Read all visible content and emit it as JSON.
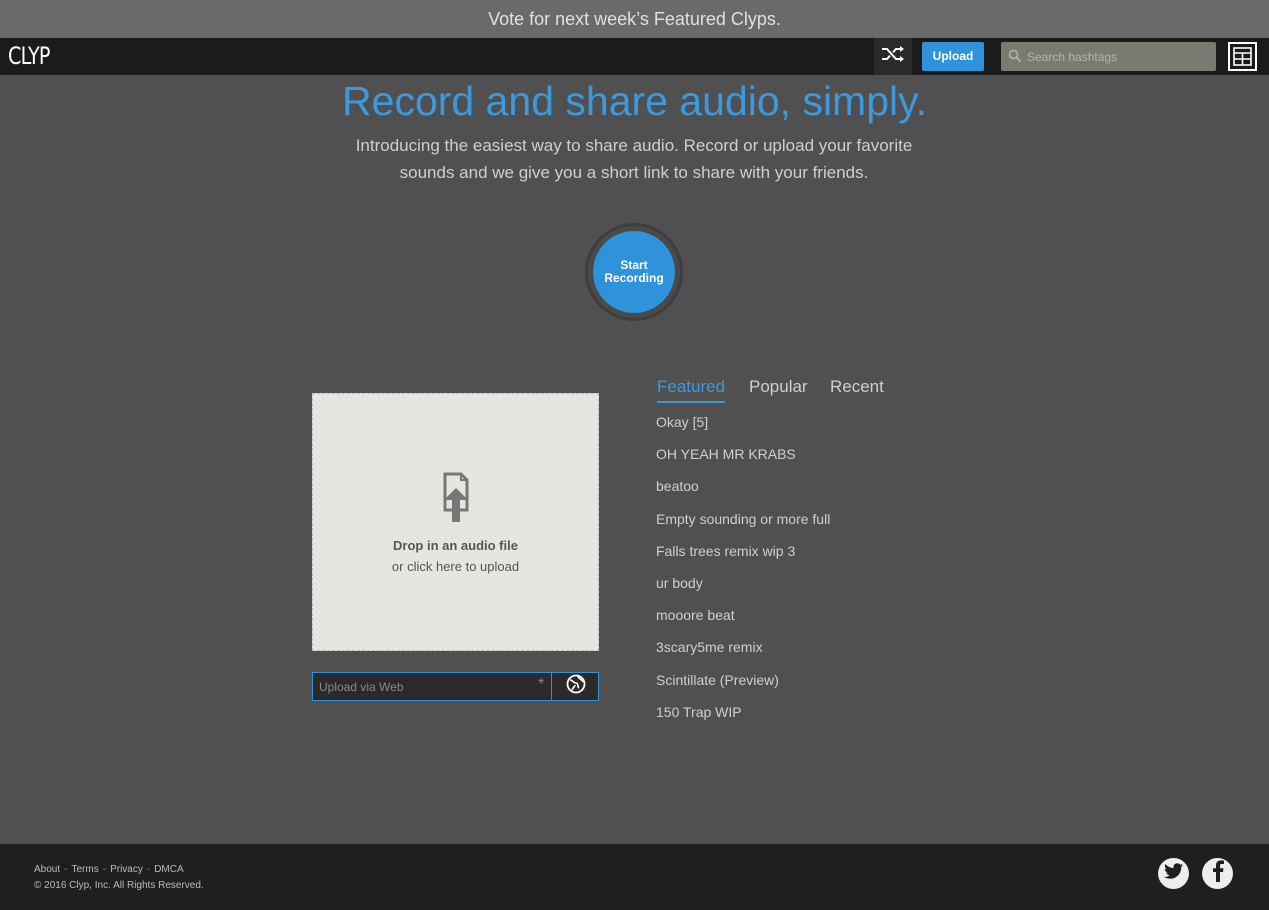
{
  "banner": {
    "text": "Vote for next week’s Featured Clyps."
  },
  "navbar": {
    "logo": "CLYP",
    "upload_label": "Upload",
    "search_placeholder": "Search hashtags"
  },
  "hero": {
    "title": "Record and share audio, simply.",
    "subtitle_line1": "Introducing the easiest way to share audio. Record or upload your favorite",
    "subtitle_line2": "sounds and we give you a short link to share with your friends."
  },
  "record": {
    "line1": "Start",
    "line2": "Recording"
  },
  "dropzone": {
    "title": "Drop in an audio file",
    "subtitle": "or click here to upload"
  },
  "web_upload": {
    "placeholder": "Upload via Web",
    "marker": "*"
  },
  "tabs": [
    {
      "label": "Featured",
      "active": true
    },
    {
      "label": "Popular",
      "active": false
    },
    {
      "label": "Recent",
      "active": false
    }
  ],
  "clips": [
    "Okay [5]",
    "OH YEAH MR KRABS",
    "beatoo",
    "Empty sounding or more full",
    "Falls trees remix wip 3",
    "ur body",
    "mooore beat",
    "3scary5me remix",
    "Scintillate (Preview)",
    "150 Trap WIP"
  ],
  "footer": {
    "links": [
      "About",
      "Terms",
      "Privacy",
      "DMCA"
    ],
    "separator": "-",
    "copyright": "© 2016 Clyp, Inc. All Rights Reserved."
  },
  "colors": {
    "accent": "#2f93db",
    "background": "#505050",
    "navbar": "#1b1b1b",
    "footer": "#1f1f1f"
  },
  "icons": [
    "shuffle-icon",
    "search-icon",
    "menu-grid-icon",
    "file-upload-icon",
    "globe-icon",
    "twitter-icon",
    "facebook-icon"
  ]
}
